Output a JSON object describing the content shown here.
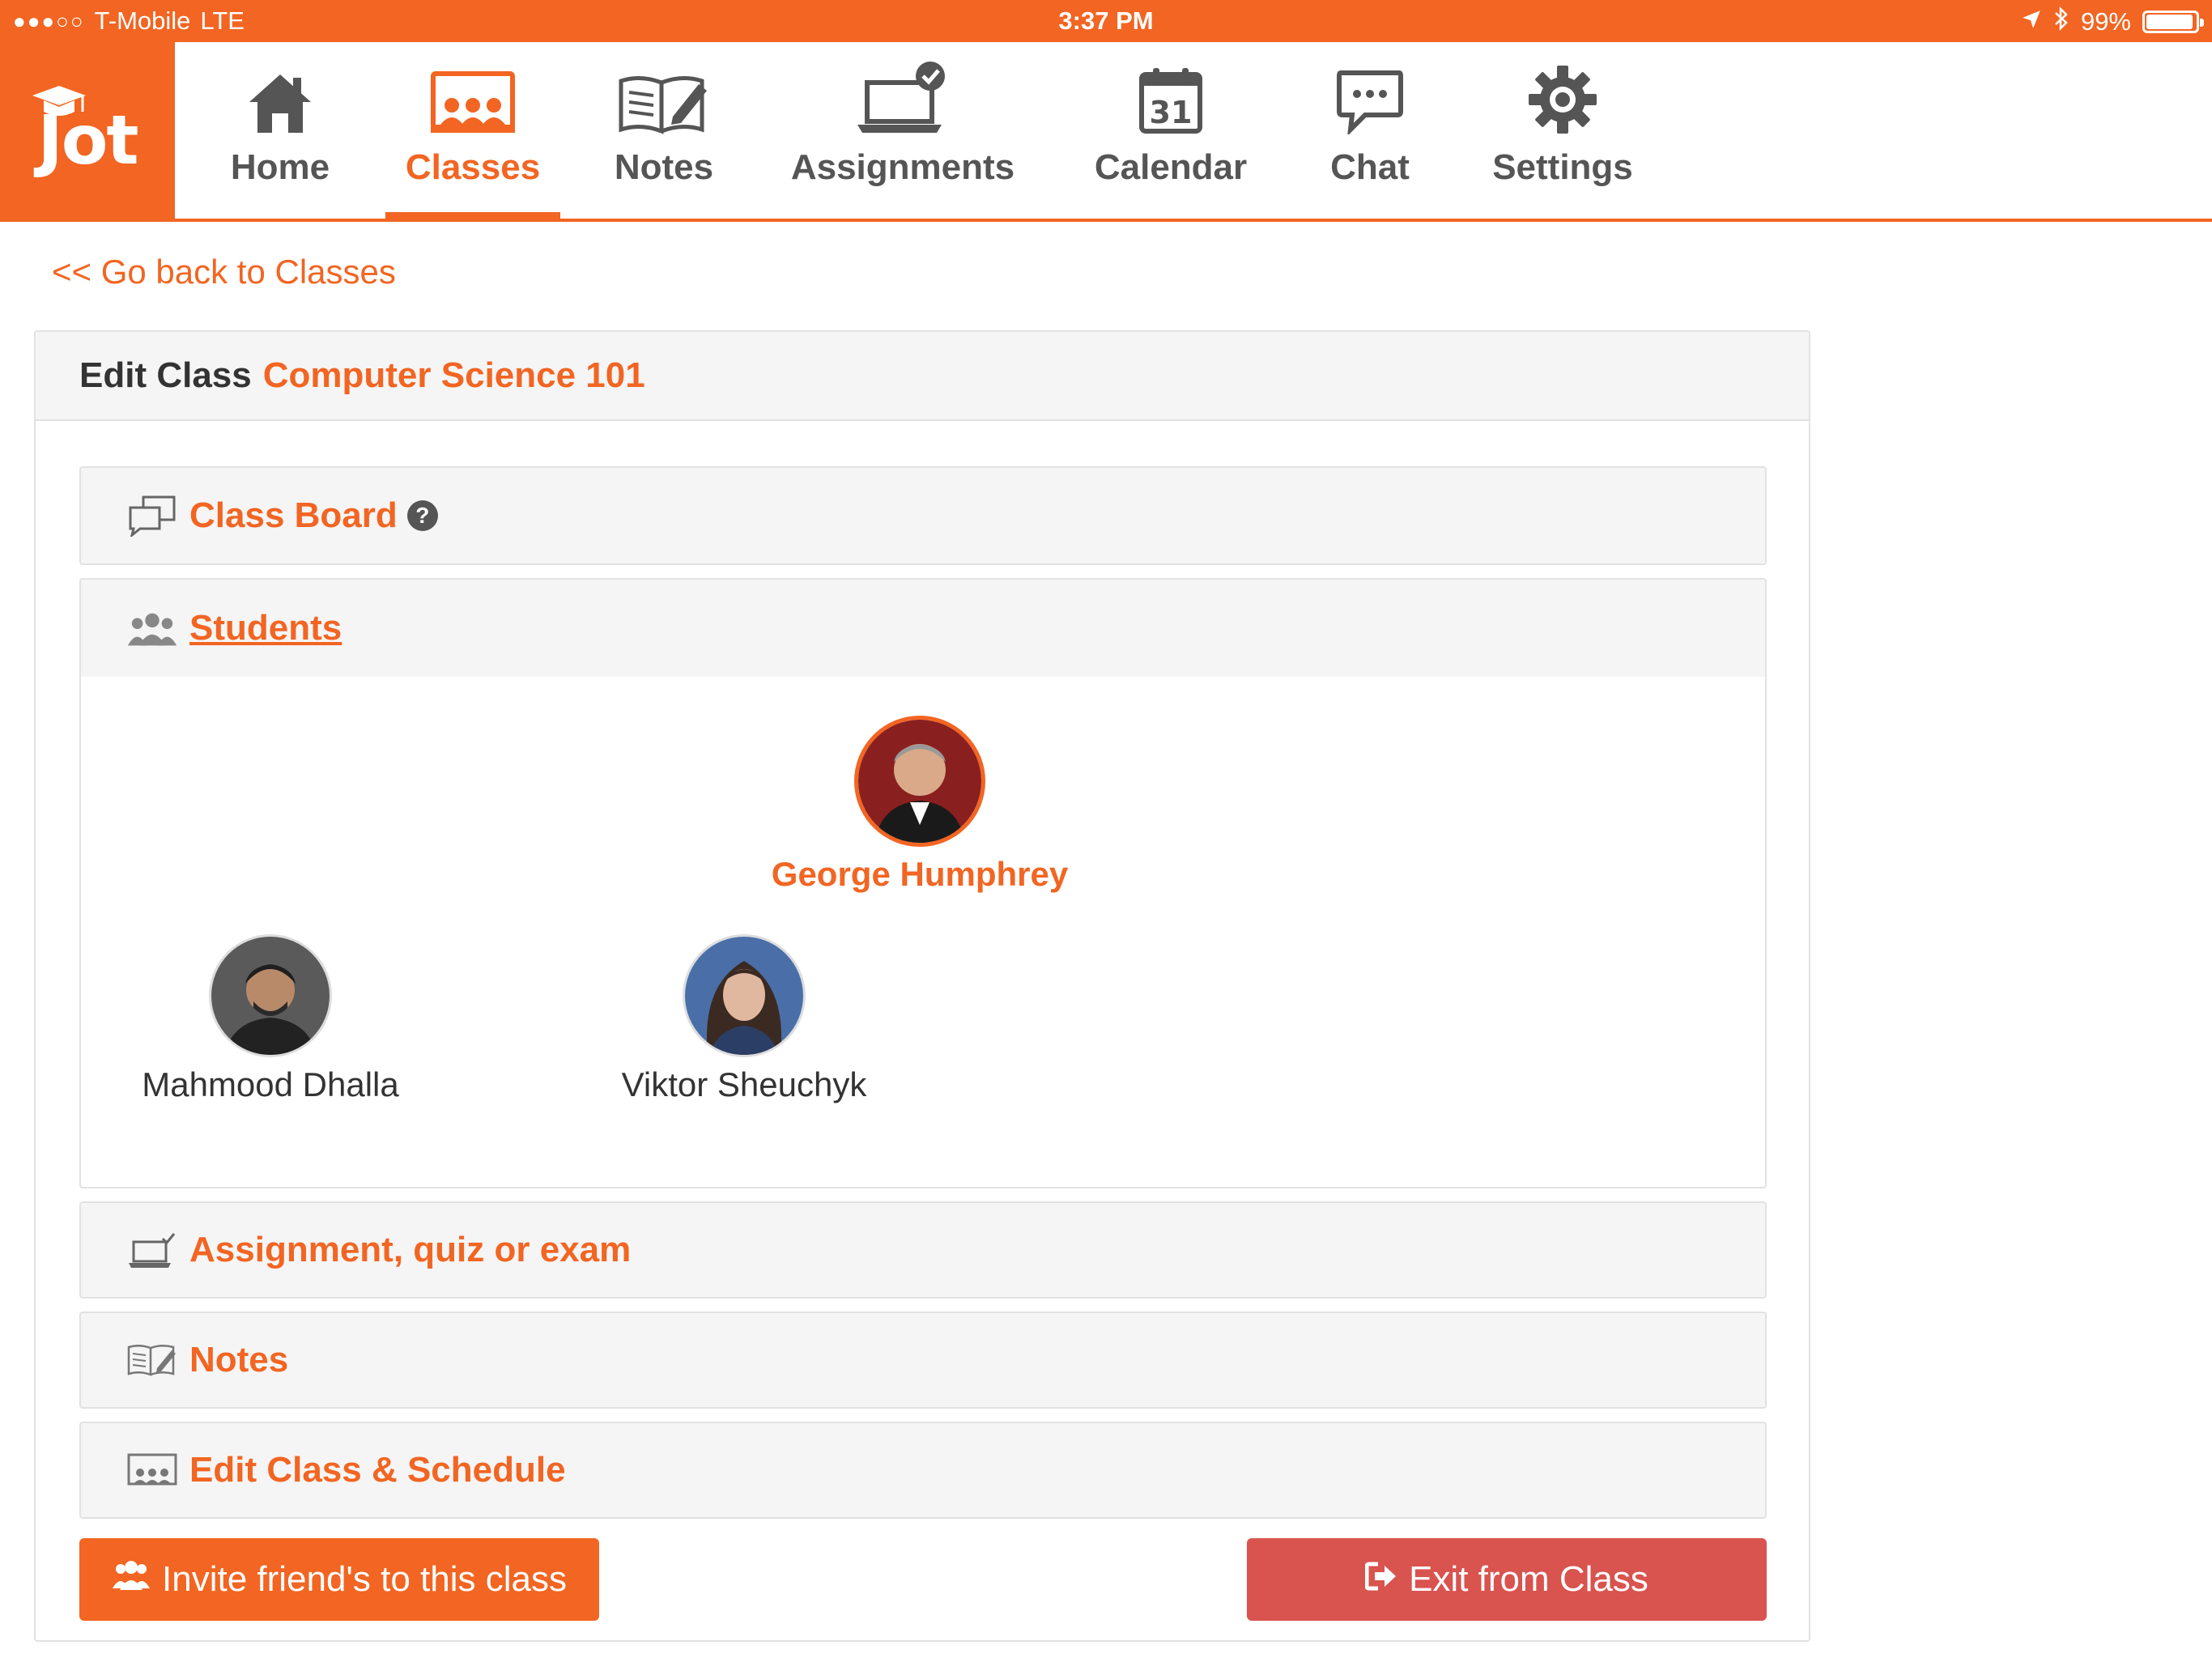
{
  "status_bar": {
    "carrier": "T-Mobile",
    "network": "LTE",
    "time": "3:37 PM",
    "battery": "99%",
    "battery_level": 0.99
  },
  "app": {
    "logo_text": "Jot"
  },
  "nav": {
    "items": [
      {
        "label": "Home",
        "icon": "home-icon"
      },
      {
        "label": "Classes",
        "icon": "classroom-icon",
        "active": true
      },
      {
        "label": "Notes",
        "icon": "notebook-icon"
      },
      {
        "label": "Assignments",
        "icon": "laptop-check-icon"
      },
      {
        "label": "Calendar",
        "icon": "calendar-icon",
        "day": "31"
      },
      {
        "label": "Chat",
        "icon": "chat-icon"
      },
      {
        "label": "Settings",
        "icon": "gear-icon"
      }
    ]
  },
  "back_link": "<< Go back to Classes",
  "edit_class": {
    "label": "Edit Class",
    "class_name": "Computer Science 101"
  },
  "sections": {
    "class_board": {
      "label": "Class Board",
      "help": "?"
    },
    "students": {
      "label": "Students"
    },
    "assignment": {
      "label": "Assignment, quiz or exam"
    },
    "notes": {
      "label": "Notes"
    },
    "edit_schedule": {
      "label": "Edit Class & Schedule"
    }
  },
  "teacher": {
    "name": "George Humphrey"
  },
  "students": [
    {
      "name": "Mahmood Dhalla"
    },
    {
      "name": "Viktor Sheuchyk"
    }
  ],
  "buttons": {
    "invite": "Invite friend's to this class",
    "exit": "Exit from Class"
  },
  "colors": {
    "accent": "#f26522",
    "danger": "#d9534f",
    "panel_bg": "#f5f5f5"
  }
}
